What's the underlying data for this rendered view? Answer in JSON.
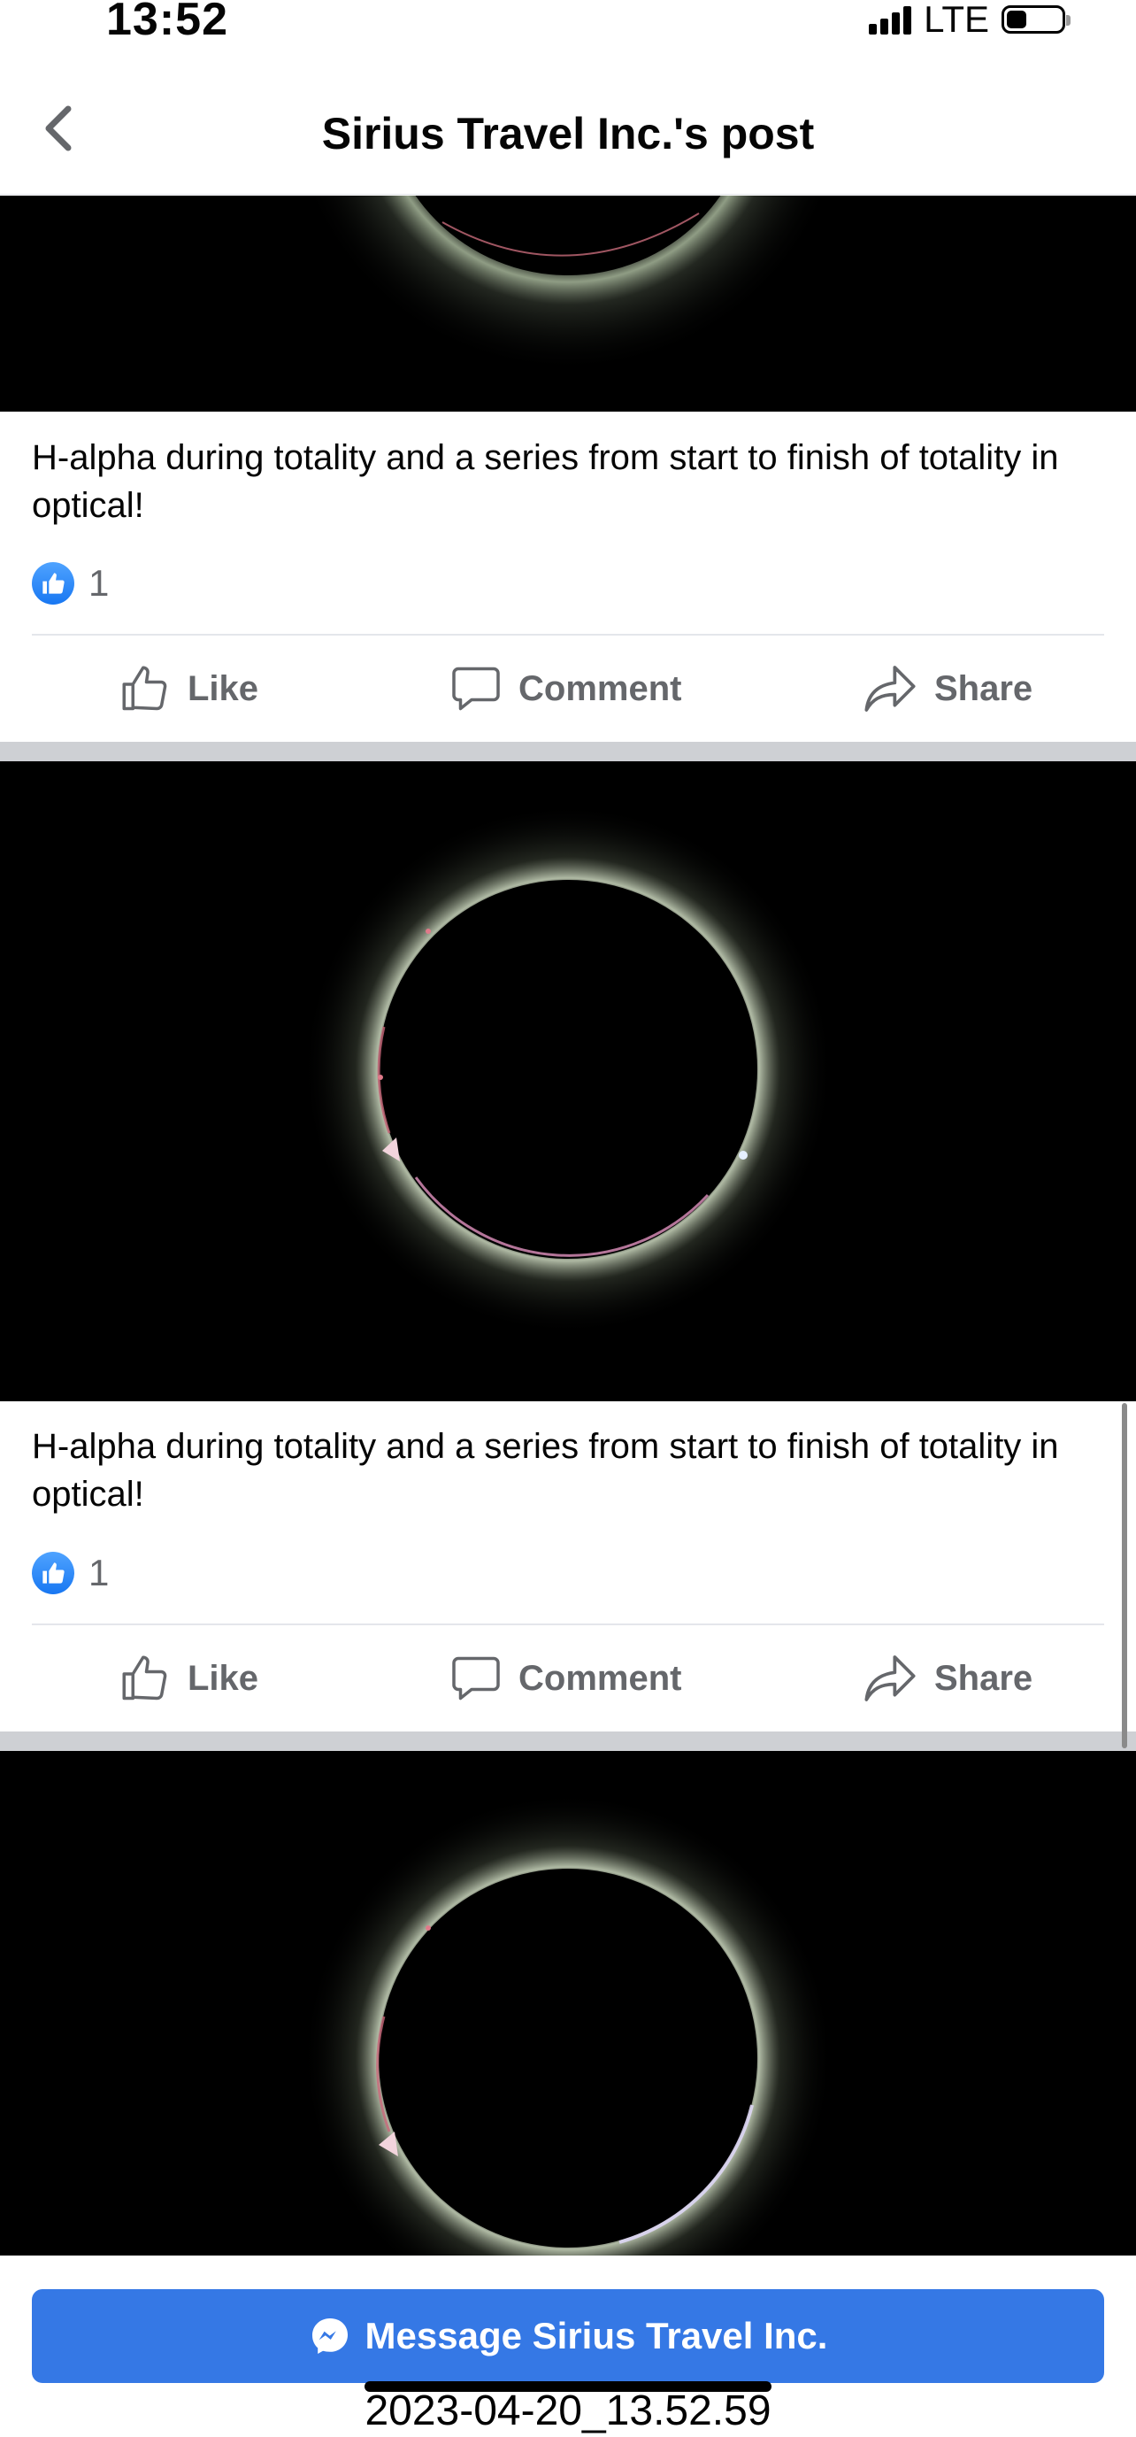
{
  "status_bar": {
    "time": "13:52",
    "network": "LTE"
  },
  "header": {
    "title": "Sirius Travel Inc.'s post"
  },
  "posts": [
    {
      "caption": "H-alpha during totality and a series from start to finish of totality in optical!",
      "reaction_count": "1",
      "actions": {
        "like": "Like",
        "comment": "Comment",
        "share": "Share"
      }
    },
    {
      "caption": "H-alpha during totality and a series from start to finish of totality in optical!",
      "reaction_count": "1",
      "actions": {
        "like": "Like",
        "comment": "Comment",
        "share": "Share"
      }
    }
  ],
  "bottom_bar": {
    "message_button": "Message Sirius Travel Inc."
  },
  "screenshot_label": "2023-04-20_13.52.59",
  "colors": {
    "brand_blue": "#3578e5",
    "like_blue": "#1877f2",
    "secondary_text": "#65676b",
    "section_gap": "#ced0d4"
  }
}
